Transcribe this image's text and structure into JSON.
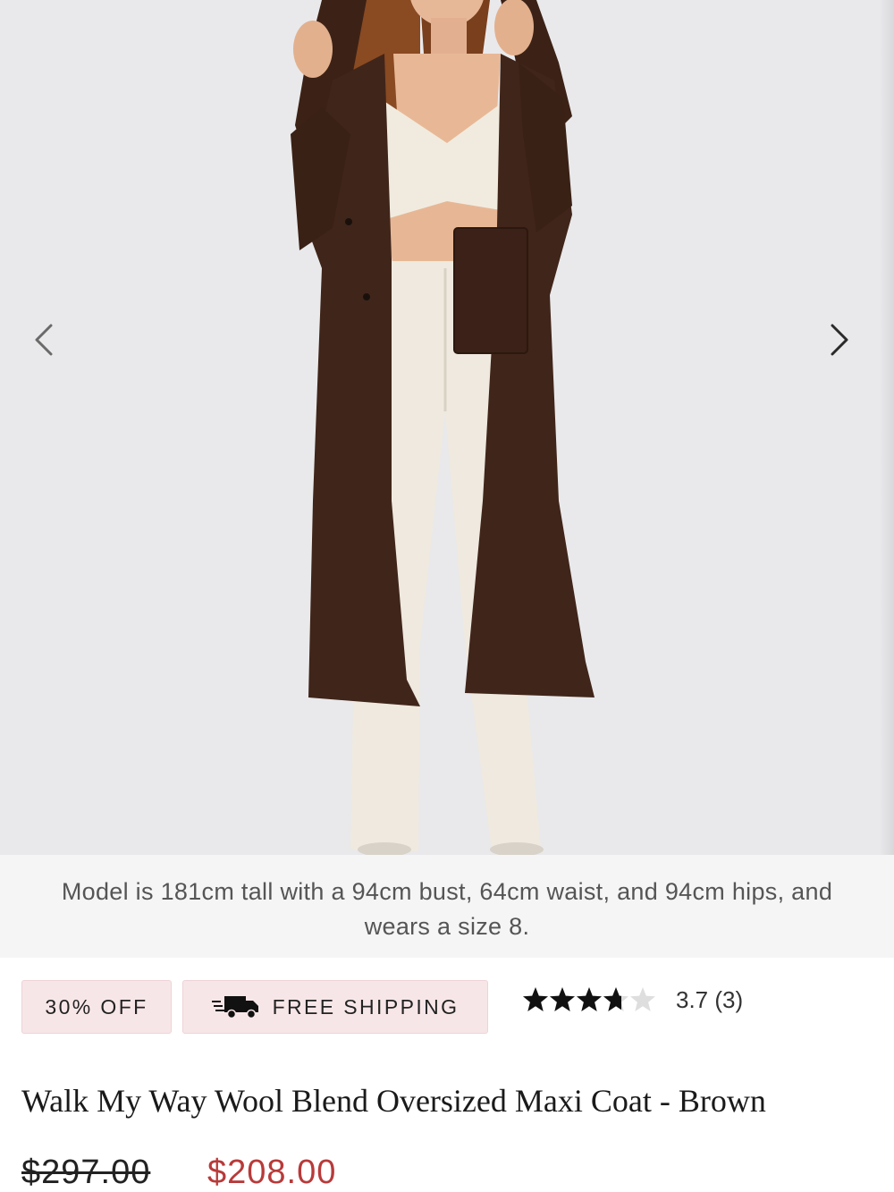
{
  "gallery": {
    "image_alt": "Model wearing brown wool blend oversized maxi coat with hood over cream top and wide-leg trousers",
    "prev_icon": "chevron-left-icon",
    "next_icon": "chevron-right-icon"
  },
  "caption": {
    "text": "Model is 181cm tall with a 94cm bust, 64cm waist, and 94cm hips, and wears a size 8."
  },
  "badges": {
    "discount": "30% OFF",
    "shipping": "FREE SHIPPING",
    "shipping_icon": "delivery-truck-icon"
  },
  "rating": {
    "stars": 3.7,
    "max_stars": 5,
    "text": "3.7 (3)"
  },
  "product": {
    "title": "Walk My Way Wool Blend Oversized Maxi Coat - Brown",
    "price_original": "$297.00",
    "price_sale": "$208.00"
  },
  "colors": {
    "sale_price": "#b83a3a",
    "badge_bg": "#f7e6e8",
    "gallery_bg": "#e9e9eb",
    "coat": "#3f2418"
  }
}
